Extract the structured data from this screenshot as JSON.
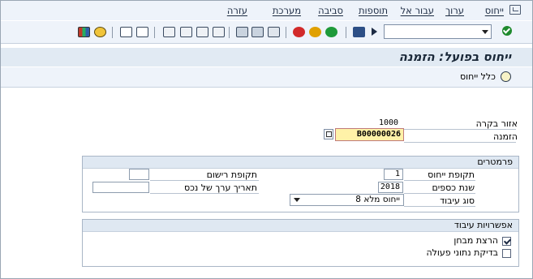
{
  "menu": {
    "items": [
      "ייחוס",
      "ערוך",
      "עבור אל",
      "תוספות",
      "סביבה",
      "מערכת",
      "עזרה"
    ]
  },
  "toolbar": {
    "command_field": "",
    "icons": [
      "enter-icon",
      "back-icon",
      "exit-icon",
      "cancel-icon",
      "print-icon",
      "find-icon",
      "find-next-icon",
      "first-page-icon",
      "previous-page-icon",
      "next-page-icon",
      "last-page-icon",
      "create-session-icon",
      "shortcut-icon",
      "help-icon",
      "layout-icon"
    ]
  },
  "page": {
    "title": "ייחוס בפועל: הזמנה",
    "app_toolbar_label": "כלל ייחוס"
  },
  "header_fields": {
    "controlling_area_label": "אזור בקרה",
    "controlling_area_value": "1000",
    "order_label": "הזמנה",
    "order_value": "B00000026"
  },
  "parameters": {
    "title": "פרמטרים",
    "settlement_period_label": "תקופת ייחוס",
    "settlement_period_value": "1",
    "fiscal_year_label": "שנת כספים",
    "fiscal_year_value": "2018",
    "processing_type_label": "סוג עיבוד",
    "processing_type_value": "8 ייחוס מלא",
    "posting_period_label": "תקופת רישום",
    "posting_period_value": "",
    "asset_value_date_label": "תאריך ערך של נכס",
    "asset_value_date_value": ""
  },
  "processing_options": {
    "title": "אפשרויות עיבוד",
    "test_run_label": "הרצת מבחן",
    "test_run_checked": true,
    "check_transaction_data_label": "בדיקת נתוני פעולה",
    "check_transaction_data_checked": false
  }
}
